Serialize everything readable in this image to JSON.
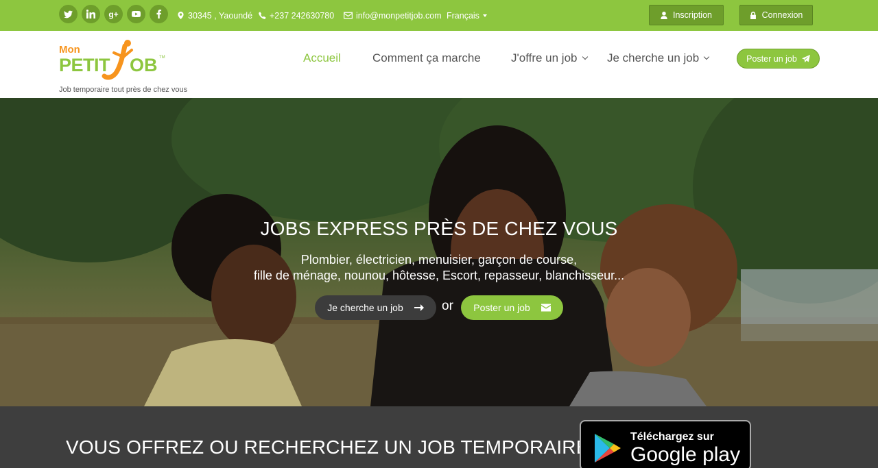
{
  "topbar": {
    "social_icons": [
      "twitter-icon",
      "linkedin-icon",
      "google-plus-icon",
      "youtube-icon",
      "facebook-icon"
    ],
    "address": "30345 , Yaoundé",
    "phone": "+237 242630780",
    "email": "info@monpetitjob.com",
    "language": "Français",
    "register_label": "Inscription",
    "login_label": "Connexion"
  },
  "header": {
    "logo_text": "Mon PETIT JOB",
    "tagline": "Job temporaire tout près de chez vous",
    "nav": [
      {
        "label": "Accueil"
      },
      {
        "label": "Comment ça marche"
      },
      {
        "label": "J'offre un job"
      },
      {
        "label": "Je cherche un job"
      }
    ],
    "post_job_label": "Poster un job"
  },
  "hero": {
    "title": "JOBS EXPRESS PRÈS DE CHEZ VOUS",
    "subtitle_line1": "Plombier, électricien, menuisier, garçon de course,",
    "subtitle_line2": "fille de ménage, nounou, hôtesse, Escort, repasseur, blanchisseur...",
    "search_btn": "Je cherche un job",
    "or": "or",
    "post_btn": "Poster un job"
  },
  "band": {
    "title": "VOUS OFFREZ OU RECHERCHEZ UN JOB TEMPORAIRE?",
    "store_small": "Téléchargez sur",
    "store_big": "Google play"
  },
  "colors": {
    "brand_green": "#8dc63f",
    "dark_green": "#6e9e2b",
    "logo_orange": "#f7941d",
    "band_dark": "#3e3e3e"
  }
}
